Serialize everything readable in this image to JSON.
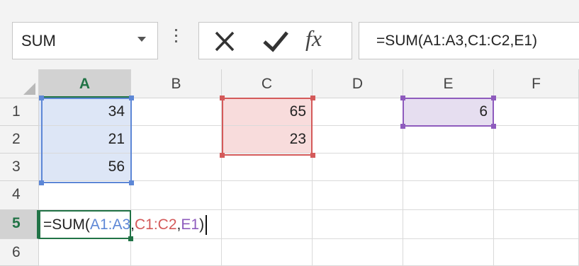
{
  "name_box": {
    "value": "SUM"
  },
  "formula_bar": {
    "cancel_label": "×",
    "enter_label": "✓",
    "fx_label": "fx",
    "formula": "=SUM(A1:A3,C1:C2,E1)"
  },
  "columns": [
    "A",
    "B",
    "C",
    "D",
    "E",
    "F"
  ],
  "rows": [
    "1",
    "2",
    "3",
    "4",
    "5",
    "6"
  ],
  "cells": {
    "A1": "34",
    "A2": "21",
    "A3": "56",
    "C1": "65",
    "C2": "23",
    "E1": "6"
  },
  "edit": {
    "prefix": "=SUM(",
    "ref1": "A1:A3",
    "sep1": ",",
    "ref2": "C1:C2",
    "sep2": ",",
    "ref3": "E1",
    "suffix": ")"
  },
  "colors": {
    "ref1": "#5d87d6",
    "ref2": "#d45a5a",
    "ref3": "#8e5bbd",
    "active": "#217346"
  }
}
